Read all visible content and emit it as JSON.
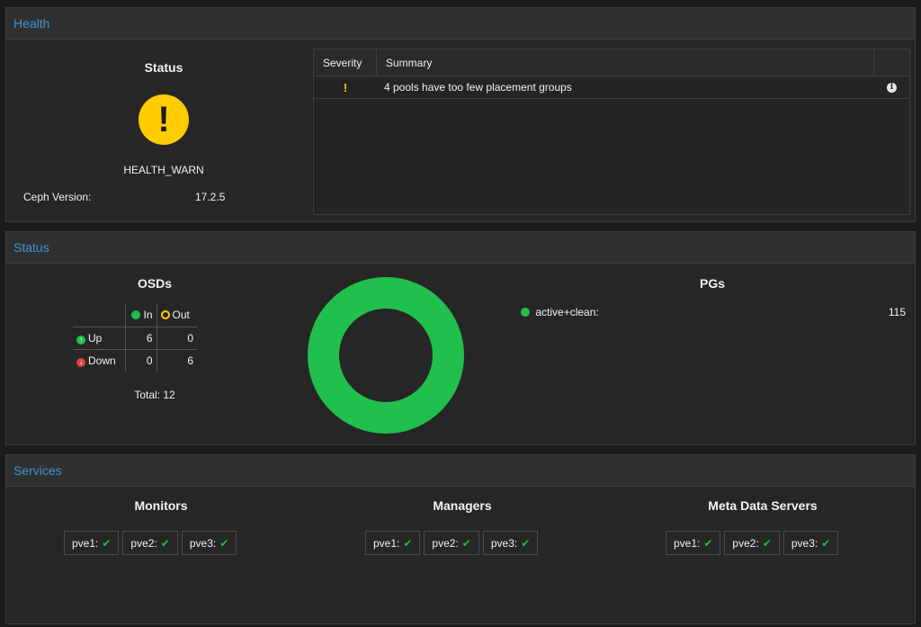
{
  "health": {
    "panel_title": "Health",
    "status_title": "Status",
    "status_icon": "warning-circle-icon",
    "status_color": "#ffcc00",
    "state": "HEALTH_WARN",
    "ceph_version_label": "Ceph Version:",
    "ceph_version": "17.2.5",
    "grid": {
      "columns": [
        "Severity",
        "Summary"
      ],
      "rows": [
        {
          "severity": "!",
          "summary": "4 pools have too few placement groups",
          "action_icon": "info-icon"
        }
      ]
    }
  },
  "status": {
    "panel_title": "Status",
    "osds": {
      "title": "OSDs",
      "col_in": "In",
      "col_out": "Out",
      "row_up": "Up",
      "row_down": "Down",
      "up_in": "6",
      "up_out": "0",
      "down_in": "0",
      "down_out": "6",
      "total": "Total: 12"
    },
    "pgs": {
      "title": "PGs",
      "items": [
        {
          "label": "active+clean:",
          "value": "115",
          "color": "#21bf4b"
        }
      ]
    }
  },
  "services": {
    "panel_title": "Services",
    "groups": [
      {
        "title": "Monitors",
        "nodes": [
          "pve1:",
          "pve2:",
          "pve3:"
        ]
      },
      {
        "title": "Managers",
        "nodes": [
          "pve1:",
          "pve2:",
          "pve3:"
        ]
      },
      {
        "title": "Meta Data Servers",
        "nodes": [
          "pve1:",
          "pve2:",
          "pve3:"
        ]
      }
    ]
  },
  "colors": {
    "accent": "#3a95d7",
    "ok": "#21bf4b",
    "warn": "#ffcc00",
    "error": "#e04141"
  }
}
